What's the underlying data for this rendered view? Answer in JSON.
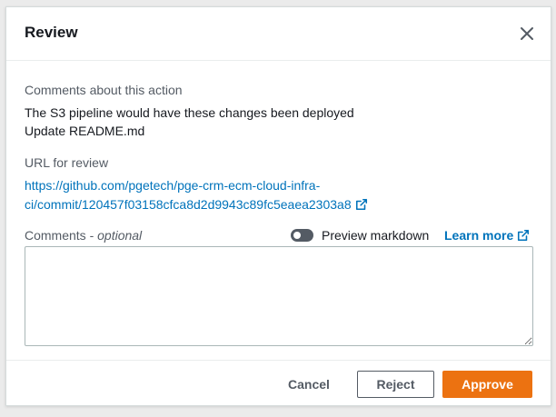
{
  "dialog": {
    "title": "Review",
    "close_icon": "close-icon"
  },
  "comments_action": {
    "label": "Comments about this action",
    "line1": "The S3 pipeline would have these changes been deployed",
    "line2": "Update README.md"
  },
  "url_review": {
    "label": "URL for review",
    "url_line1": "https://github.com/pgetech/pge-crm-ecm-cloud-infra-",
    "url_line2": "ci/commit/120457f03158cfca8d2d9943c89fc5eaea2303a8",
    "icon": "external-link-icon"
  },
  "comments_input": {
    "label_main": "Comments - ",
    "label_optional": "optional",
    "value": "",
    "placeholder": ""
  },
  "preview_toggle": {
    "label": "Preview markdown",
    "enabled": false
  },
  "learn_more": {
    "label": "Learn more",
    "icon": "external-link-icon"
  },
  "footer": {
    "cancel_label": "Cancel",
    "reject_label": "Reject",
    "approve_label": "Approve"
  },
  "colors": {
    "link": "#0073bb",
    "primary": "#ec7211",
    "toggle_off": "#545b64"
  }
}
